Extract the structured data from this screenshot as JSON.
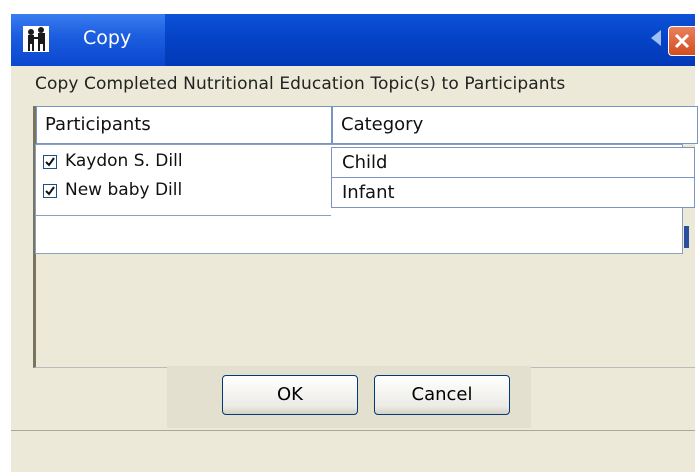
{
  "window": {
    "title": "Copy"
  },
  "instruction": "Copy Completed Nutritional Education Topic(s) to Participants",
  "grid": {
    "headers": {
      "participants": "Participants",
      "category": "Category"
    },
    "participants": [
      {
        "name": "Kaydon S. Dill",
        "checked": true
      },
      {
        "name": "New baby Dill",
        "checked": true
      }
    ],
    "categories": [
      "Child",
      "Infant"
    ]
  },
  "buttons": {
    "ok": "OK",
    "cancel": "Cancel"
  },
  "colors": {
    "title_bar": "#0a46cf",
    "close_button": "#d24d20",
    "dialog_bg": "#ece9d8"
  }
}
